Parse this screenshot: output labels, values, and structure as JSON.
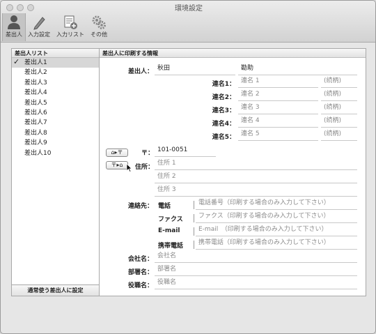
{
  "window": {
    "title": "環境設定"
  },
  "toolbar": {
    "items": [
      {
        "label": "差出人",
        "icon": "person-icon"
      },
      {
        "label": "入力設定",
        "icon": "pencil-icon"
      },
      {
        "label": "入力リスト",
        "icon": "list-add-icon"
      },
      {
        "label": "その他",
        "icon": "gears-icon"
      }
    ]
  },
  "sender_list": {
    "header": "差出人リスト",
    "items": [
      "差出人1",
      "差出人2",
      "差出人3",
      "差出人4",
      "差出人5",
      "差出人6",
      "差出人7",
      "差出人8",
      "差出人9",
      "差出人10"
    ],
    "selected_index": 0,
    "footer_button": "通常使う差出人に設定"
  },
  "info": {
    "header": "差出人に印刷する情報",
    "sender_label": "差出人：",
    "last_name": "秋田",
    "first_name": "勘助",
    "joint": [
      {
        "label": "連名1：",
        "name_placeholder": "連名 1",
        "honorific": "(続柄)"
      },
      {
        "label": "連名2：",
        "name_placeholder": "連名 2",
        "honorific": "(続柄)"
      },
      {
        "label": "連名3：",
        "name_placeholder": "連名 3",
        "honorific": "(続柄)"
      },
      {
        "label": "連名4：",
        "name_placeholder": "連名 4",
        "honorific": "(続柄)"
      },
      {
        "label": "連名5：",
        "name_placeholder": "連名 5",
        "honorific": "(続柄)"
      }
    ],
    "zip_button": "⌂▸〒",
    "addr_button": "〒▸⌂",
    "zip_label": "〒：",
    "zip_value": "101-0051",
    "address_label": "住所：",
    "address_placeholders": [
      "住所 1",
      "住所 2",
      "住所 3"
    ],
    "contact_label": "連絡先：",
    "contacts": [
      {
        "type": "電話",
        "placeholder": "電話番号（印刷する場合のみ入力して下さい）"
      },
      {
        "type": "ファクス",
        "placeholder": "ファクス（印刷する場合のみ入力して下さい）"
      },
      {
        "type": "E-mail",
        "placeholder": "E-mail　（印刷する場合のみ入力して下さい）"
      },
      {
        "type": "携帯電話",
        "placeholder": "携帯電話（印刷する場合のみ入力して下さい）"
      }
    ],
    "company_label": "会社名：",
    "company_placeholder": "会社名",
    "department_label": "部署名：",
    "department_placeholder": "部署名",
    "position_label": "役職名：",
    "position_placeholder": "役職名"
  }
}
